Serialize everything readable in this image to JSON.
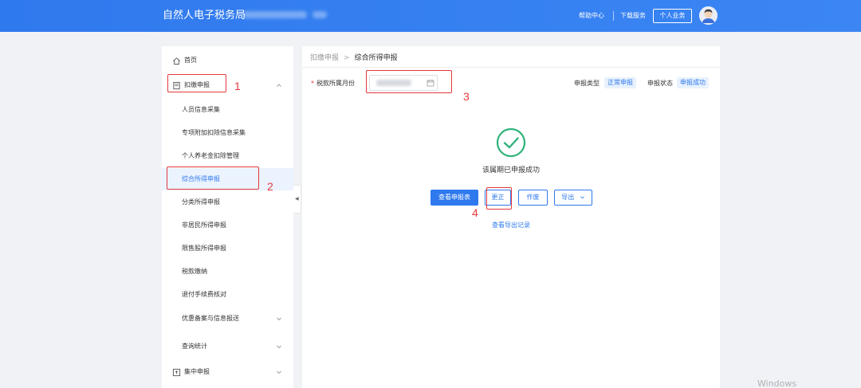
{
  "header": {
    "brand": "自然人电子税务局",
    "help_center": "帮助中心",
    "download_service": "下载服务",
    "personal_business": "个人业务"
  },
  "sidebar": {
    "home": "首页",
    "withholding": "扣缴申报",
    "sub_items": [
      "人员信息采集",
      "专项附加扣除信息采集",
      "个人养老金扣除管理",
      "综合所得申报",
      "分类所得申报",
      "非居民所得申报",
      "限售股所得申报",
      "税款缴纳",
      "退付手续费核对",
      "优惠备案与信息报送",
      "查询统计"
    ],
    "centralized": "集中申报",
    "active_index": 3
  },
  "breadcrumb": {
    "parent": "扣缴申报",
    "separator": ">",
    "current": "综合所得申报"
  },
  "form": {
    "required_mark": "*",
    "period_label": "税款所属月份",
    "declare_type_label": "申报类型",
    "declare_type_value": "正常申报",
    "declare_status_label": "申报状态",
    "declare_status_value": "申报成功"
  },
  "result": {
    "message": "该属期已申报成功",
    "view_report": "查看申报表",
    "correct": "更正",
    "void": "作废",
    "export": "导出",
    "export_records": "查看导出记录"
  },
  "annotations": [
    "1",
    "2",
    "3",
    "4"
  ],
  "colors": {
    "primary": "#2f79ee",
    "success": "#2fb37a",
    "annotation": "#e4393c"
  }
}
